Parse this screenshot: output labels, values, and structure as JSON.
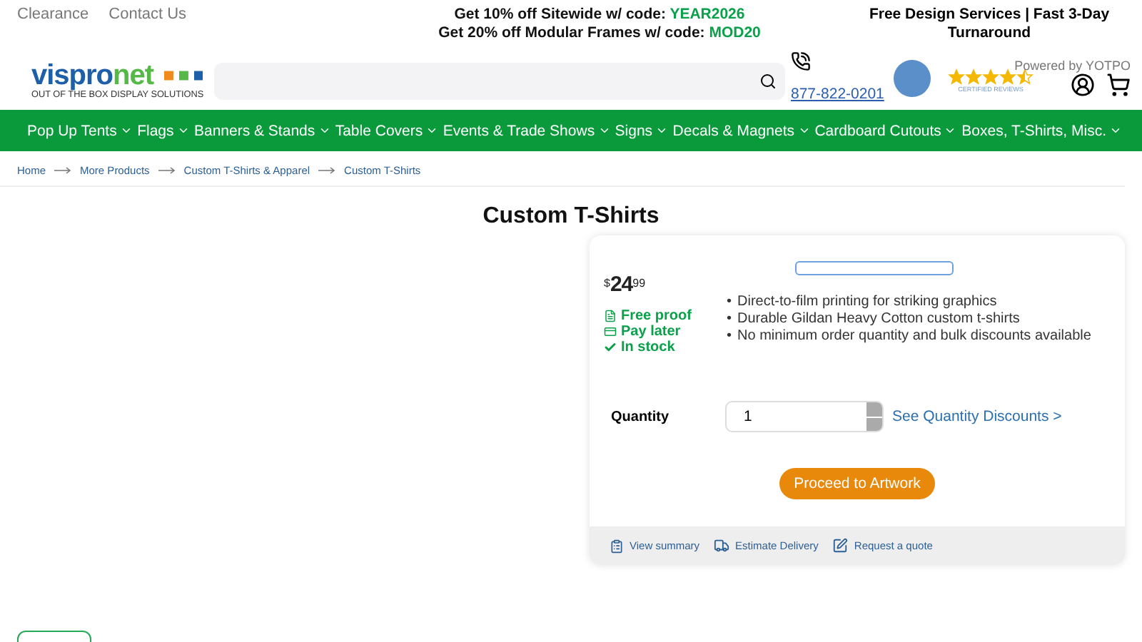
{
  "top_links": [
    "Clearance",
    "Contact Us"
  ],
  "promos": [
    {
      "text": "Get 10% off Sitewide w/ code: ",
      "code": "YEAR2026"
    },
    {
      "text": "Get 20% off Modular Frames w/ code: ",
      "code": "MOD20"
    }
  ],
  "service_note": "Free Design Services | Fast 3-Day Turnaround",
  "logo": {
    "brand_a": "vispro",
    "brand_b": "net",
    "tagline": "OUT OF THE BOX DISPLAY SOLUTIONS"
  },
  "phone": "877-822-0201",
  "reviews": {
    "stars": 4.5,
    "powered_by": "Powered by YOTPO",
    "caption": "CERTIFIED REVIEWS"
  },
  "nav": [
    "Pop Up Tents",
    "Flags",
    "Banners & Stands",
    "Table Covers",
    "Events & Trade Shows",
    "Signs",
    "Decals & Magnets",
    "Cardboard Cutouts",
    "Boxes, T-Shirts, Misc."
  ],
  "breadcrumb": [
    "Home",
    "More Products",
    "Custom T-Shirts & Apparel",
    "Custom T-Shirts"
  ],
  "title": "Custom T-Shirts",
  "product": {
    "currency": "$",
    "price": "24",
    "cents": "99",
    "perks": [
      {
        "kind": "proof",
        "text": "Free proof"
      },
      {
        "kind": "pay",
        "text": "Pay later"
      },
      {
        "kind": "stock",
        "text": "In stock"
      }
    ],
    "bullet": "•",
    "features": [
      "Direct-to-film printing for striking graphics",
      "Durable Gildan Heavy Cotton custom t-shirts",
      "No minimum order quantity and bulk discounts available"
    ],
    "quantity_label": "Quantity",
    "quantity": "1",
    "discounts_link": "See Quantity Discounts >",
    "proceed": "Proceed to Artwork",
    "actions": [
      {
        "kind": "summary",
        "text": "View summary"
      },
      {
        "kind": "delivery",
        "text": "Estimate Delivery"
      },
      {
        "kind": "quote",
        "text": "Request a quote"
      }
    ]
  }
}
